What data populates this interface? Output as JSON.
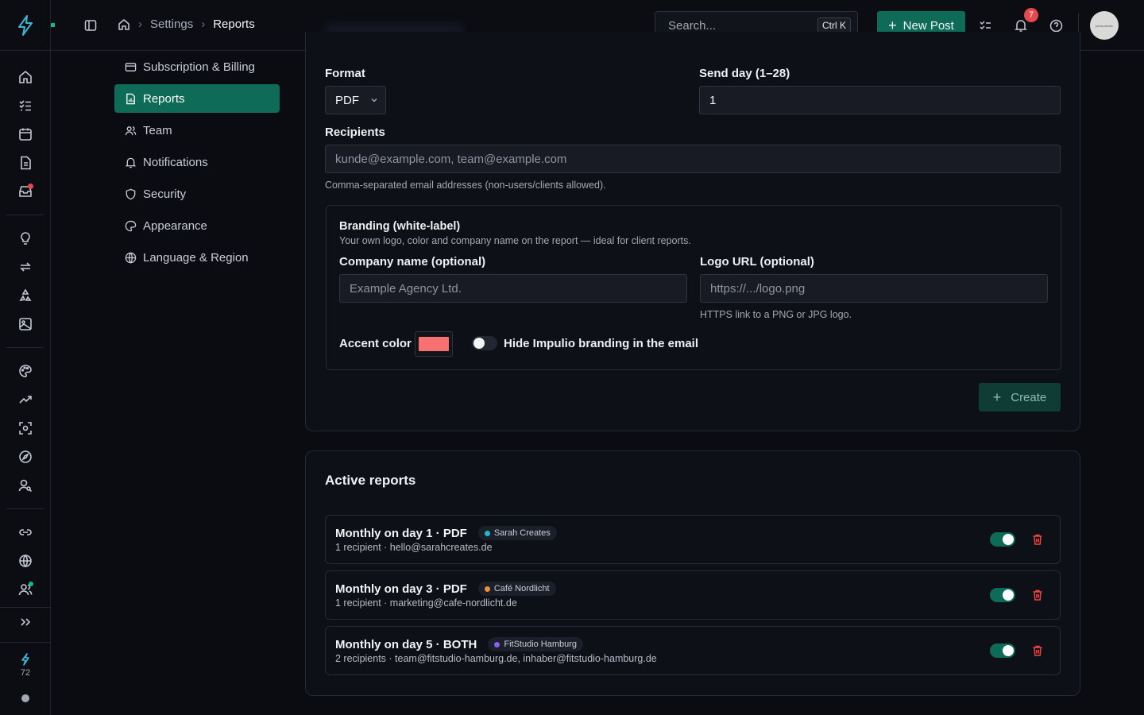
{
  "header": {
    "breadcrumb": [
      "Settings",
      "Reports"
    ],
    "search_placeholder": "Search...",
    "search_shortcut": "Ctrl K",
    "new_post_label": "New Post",
    "notification_count": "7",
    "avatar_text": "jonas-studio"
  },
  "rail": {
    "credits": "72"
  },
  "settings_nav": [
    {
      "label": "Subscription & Billing",
      "icon": "credit-card-icon"
    },
    {
      "label": "Reports",
      "icon": "file-chart-icon",
      "active": true
    },
    {
      "label": "Team",
      "icon": "users-icon"
    },
    {
      "label": "Notifications",
      "icon": "bell-icon"
    },
    {
      "label": "Security",
      "icon": "shield-icon"
    },
    {
      "label": "Appearance",
      "icon": "palette-icon"
    },
    {
      "label": "Language & Region",
      "icon": "globe-icon"
    }
  ],
  "form": {
    "format_label": "Format",
    "format_value": "PDF",
    "send_day_label": "Send day (1–28)",
    "send_day_value": "1",
    "recipients_label": "Recipients",
    "recipients_placeholder": "kunde@example.com, team@example.com",
    "recipients_help": "Comma-separated email addresses (non-users/clients allowed).",
    "branding": {
      "title": "Branding (white-label)",
      "subtitle": "Your own logo, color and company name on the report — ideal for client reports.",
      "company_label": "Company name (optional)",
      "company_placeholder": "Example Agency Ltd.",
      "logo_label": "Logo URL (optional)",
      "logo_placeholder": "https://.../logo.png",
      "logo_help": "HTTPS link to a PNG or JPG logo.",
      "accent_label": "Accent color",
      "accent_color": "#f87171",
      "hide_branding_label": "Hide Impulio branding in the email",
      "hide_branding_on": false
    },
    "create_label": "Create"
  },
  "active_reports": {
    "title": "Active reports",
    "items": [
      {
        "title": "Monthly on day 1 · PDF",
        "client": "Sarah Creates",
        "client_color": "#22b8cf",
        "subtitle": "1 recipient · hello@sarahcreates.de",
        "enabled": true
      },
      {
        "title": "Monthly on day 3 · PDF",
        "client": "Café Nordlicht",
        "client_color": "#f08c3c",
        "subtitle": "1 recipient · marketing@cafe-nordlicht.de",
        "enabled": true
      },
      {
        "title": "Monthly on day 5 · BOTH",
        "client": "FitStudio Hamburg",
        "client_color": "#8b5cf6",
        "subtitle": "2 recipients · team@fitstudio-hamburg.de, inhaber@fitstudio-hamburg.de",
        "enabled": true
      }
    ]
  },
  "colors": {
    "accent": "#0d6b57",
    "danger": "#ef4444",
    "badge": "#e5484d"
  }
}
